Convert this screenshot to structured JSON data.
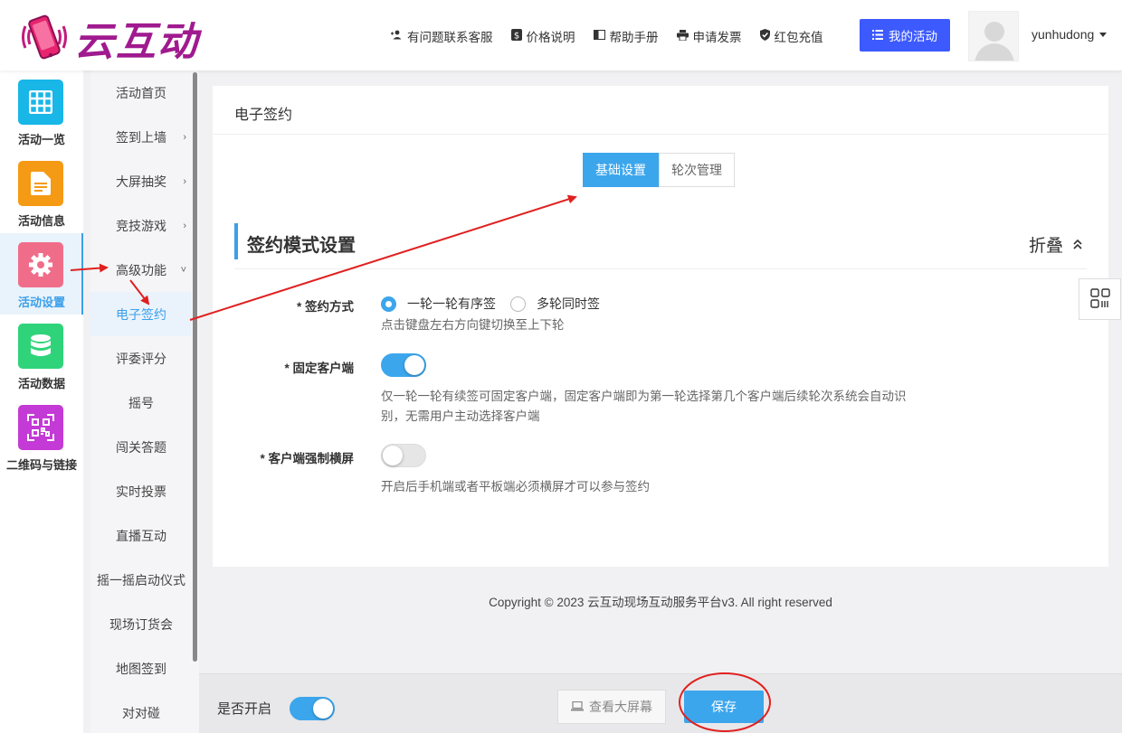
{
  "brand": {
    "name": "云互动"
  },
  "header": {
    "links": [
      {
        "label": "有问题联系客服",
        "icon": "add-user-icon"
      },
      {
        "label": "价格说明",
        "icon": "dollar-icon"
      },
      {
        "label": "帮助手册",
        "icon": "book-icon"
      },
      {
        "label": "申请发票",
        "icon": "printer-icon"
      },
      {
        "label": "红包充值",
        "icon": "shield-check-icon"
      }
    ],
    "my_activity": "我的活动",
    "username": "yunhudong"
  },
  "sidebar": {
    "items": [
      {
        "label": "活动一览",
        "color": "#19b6e8",
        "icon": "grid-icon"
      },
      {
        "label": "活动信息",
        "color": "#f59a14",
        "icon": "document-icon"
      },
      {
        "label": "活动设置",
        "color": "#f06d8a",
        "icon": "gear-icon",
        "active": true
      },
      {
        "label": "活动数据",
        "color": "#2fd47a",
        "icon": "database-icon"
      },
      {
        "label": "二维码与链接",
        "color": "#c43ad6",
        "icon": "qrcode-icon"
      }
    ]
  },
  "submenu": {
    "items": [
      {
        "label": "活动首页"
      },
      {
        "label": "签到上墙",
        "chevron": "›"
      },
      {
        "label": "大屏抽奖",
        "chevron": "›"
      },
      {
        "label": "竞技游戏",
        "chevron": "›"
      },
      {
        "label": "高级功能",
        "chevron": "˅"
      },
      {
        "label": "电子签约",
        "active": true
      },
      {
        "label": "评委评分"
      },
      {
        "label": "摇号"
      },
      {
        "label": "闯关答题"
      },
      {
        "label": "实时投票"
      },
      {
        "label": "直播互动"
      },
      {
        "label": "摇一摇启动仪式"
      },
      {
        "label": "现场订货会"
      },
      {
        "label": "地图签到"
      },
      {
        "label": "对对碰"
      }
    ]
  },
  "main": {
    "title": "电子签约",
    "tabs": [
      {
        "label": "基础设置",
        "active": true
      },
      {
        "label": "轮次管理"
      }
    ],
    "section_title": "签约模式设置",
    "fold_label": "折叠",
    "sign_mode": {
      "label": "* 签约方式",
      "options": [
        {
          "label": "一轮一轮有序签",
          "selected": true
        },
        {
          "label": "多轮同时签"
        }
      ],
      "help": "点击键盘左右方向键切换至上下轮"
    },
    "fixed_client": {
      "label": "* 固定客户端",
      "enabled": true,
      "help1": "仅一轮一轮有续签可固定客户端，固定客户端即为第一轮选择第几个客户端后续轮次系统会自动识",
      "help2": "别，无需用户主动选择客户端"
    },
    "force_landscape": {
      "label": "* 客户端强制横屏",
      "enabled": false,
      "help": "开启后手机端或者平板端必须横屏才可以参与签约"
    }
  },
  "footer": {
    "copyright": "Copyright © 2023 云互动现场互动服务平台v3. All right reserved"
  },
  "bottombar": {
    "enable_label": "是否开启",
    "enabled": true,
    "view_screen": "查看大屏幕",
    "save": "保存"
  },
  "colors": {
    "accent": "#3ca6ec",
    "brand": "#a01a8f",
    "annotation": "#e0201f"
  }
}
